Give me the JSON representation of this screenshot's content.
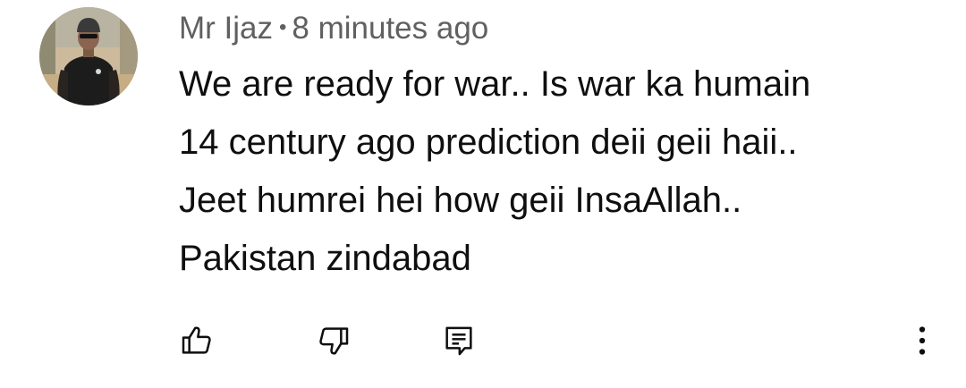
{
  "comment": {
    "author": "Mr Ijaz",
    "separator": "•",
    "timestamp": "8 minutes ago",
    "text_lines": [
      "We are ready for war.. Is war ka humain",
      "14 century ago prediction deii geii haii..",
      "Jeet humrei hei how geii InsaAllah..",
      "Pakistan zindabad"
    ]
  },
  "actions": {
    "like_icon": "thumbs-up-icon",
    "dislike_icon": "thumbs-down-icon",
    "reply_icon": "reply-comment-icon",
    "more_icon": "more-vertical-icon"
  },
  "colors": {
    "text": "#0f0f0f",
    "meta": "#606060",
    "icon": "#0f0f0f",
    "background": "#ffffff"
  }
}
